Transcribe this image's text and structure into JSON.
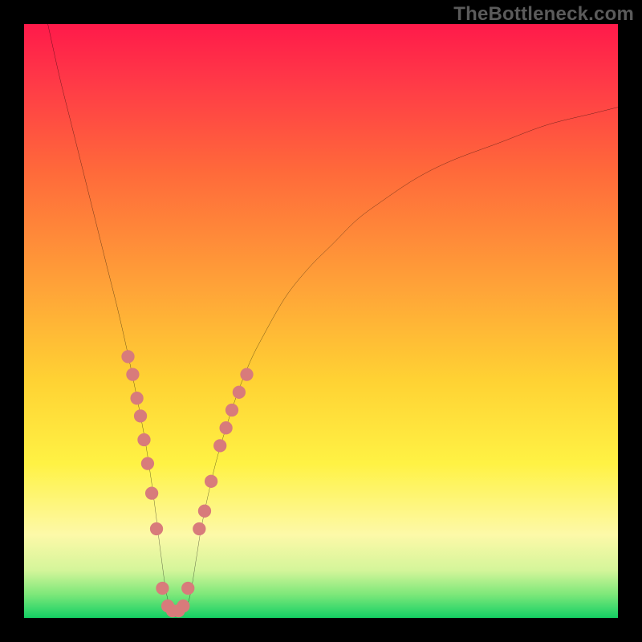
{
  "watermark": "TheBottleneck.com",
  "chart_data": {
    "type": "line",
    "title": "",
    "xlabel": "",
    "ylabel": "",
    "xlim": [
      0,
      100
    ],
    "ylim": [
      0,
      100
    ],
    "gradient_stops": [
      {
        "pos": 0,
        "color": "#ff1a4a"
      },
      {
        "pos": 10,
        "color": "#ff3a47"
      },
      {
        "pos": 25,
        "color": "#ff6a3a"
      },
      {
        "pos": 44,
        "color": "#ffa238"
      },
      {
        "pos": 60,
        "color": "#ffd233"
      },
      {
        "pos": 74,
        "color": "#fff244"
      },
      {
        "pos": 86,
        "color": "#fdf9a8"
      },
      {
        "pos": 92,
        "color": "#d4f59a"
      },
      {
        "pos": 96,
        "color": "#7ee87a"
      },
      {
        "pos": 99,
        "color": "#2ed66a"
      },
      {
        "pos": 100,
        "color": "#14cf62"
      }
    ],
    "series": [
      {
        "name": "bottleneck-curve",
        "color": "#000000",
        "x": [
          4,
          6,
          8,
          10,
          12,
          14,
          16,
          18,
          20,
          21,
          22,
          23,
          24,
          25,
          26,
          27,
          28,
          29,
          30,
          32,
          34,
          36,
          38,
          40,
          44,
          48,
          52,
          56,
          60,
          66,
          72,
          80,
          88,
          96,
          100
        ],
        "y": [
          100,
          91,
          83,
          75,
          67,
          59,
          51,
          42,
          32,
          26,
          19,
          11,
          4,
          1,
          1,
          1,
          4,
          10,
          16,
          25,
          32,
          38,
          43,
          47,
          54,
          59,
          63,
          67,
          70,
          74,
          77,
          80,
          83,
          85,
          86
        ]
      }
    ],
    "annotations": [
      {
        "name": "dot-cluster",
        "shape": "circle",
        "color": "#d87b7b",
        "radius_pct": 1.1,
        "points": [
          {
            "x": 17.5,
            "y": 44
          },
          {
            "x": 18.3,
            "y": 41
          },
          {
            "x": 19.0,
            "y": 37
          },
          {
            "x": 19.6,
            "y": 34
          },
          {
            "x": 20.2,
            "y": 30
          },
          {
            "x": 20.8,
            "y": 26
          },
          {
            "x": 21.5,
            "y": 21
          },
          {
            "x": 22.3,
            "y": 15
          },
          {
            "x": 23.3,
            "y": 5
          },
          {
            "x": 24.2,
            "y": 2
          },
          {
            "x": 25.0,
            "y": 1.2
          },
          {
            "x": 26.0,
            "y": 1.2
          },
          {
            "x": 26.8,
            "y": 2
          },
          {
            "x": 27.6,
            "y": 5
          },
          {
            "x": 29.5,
            "y": 15
          },
          {
            "x": 30.4,
            "y": 18
          },
          {
            "x": 31.5,
            "y": 23
          },
          {
            "x": 33.0,
            "y": 29
          },
          {
            "x": 34.0,
            "y": 32
          },
          {
            "x": 35.0,
            "y": 35
          },
          {
            "x": 36.2,
            "y": 38
          },
          {
            "x": 37.5,
            "y": 41
          }
        ]
      }
    ]
  }
}
